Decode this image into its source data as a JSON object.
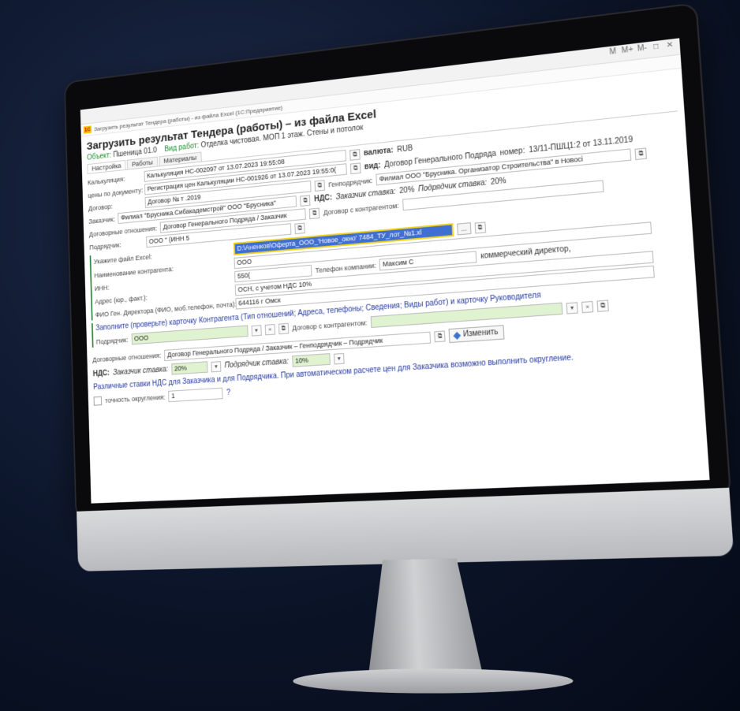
{
  "window": {
    "title": "Загрузить результат Тендера (работы) - из файла Excel (1С:Предприятие)",
    "toolbar": [
      "M",
      "M+",
      "M-",
      "□",
      "✕"
    ]
  },
  "header": {
    "title": "Загрузить результат Тендера (работы) – из файла Excel",
    "object_label": "Объект:",
    "object_value": "Пшеница 01.0",
    "work_label": "Вид работ:",
    "work_value": "Отделка чистовая. МОП 1 этаж. Стены и потолок"
  },
  "tabs": [
    "Настройка",
    "Работы",
    "Материалы"
  ],
  "form": {
    "calc_label": "Калькуляция:",
    "calc_value": "Калькуляция НС-002097 от 13.07.2023 19:55:08",
    "currency_label": "валюта:",
    "currency_value": "RUB",
    "price_doc_label": "цены по документу:",
    "price_doc_value": "Регистрация цен Калькуляции НС-001926 от 13.07.2023 19:55:0(",
    "kind_label": "вид:",
    "kind_value": "Договор Генерального Подряда",
    "number_label": "номер:",
    "number_value": "13/11-ПШЦ1:2 от 13.11.2019",
    "contract_label": "Договор:",
    "contract_value": "Договор №                    т            .2019",
    "general_contractor_label": "Генподрядчик:",
    "general_contractor_value": "Филиал ООО \"Брусника. Организатор Строительства\" в Новосі",
    "customer_label": "Заказчик:",
    "customer_value": "Филиал \"Брусника.Сибакадемстрой\" ООО \"Брусника\"",
    "vat_label": "НДС:",
    "customer_rate_label": "Заказчик ставка:",
    "customer_rate_value": "20%",
    "contractor_rate_label": "Подрядчик ставка:",
    "contractor_rate_value": "20%",
    "relations_label": "Договорные отношения:",
    "relations_value": "Договор Генерального Подряда / Заказчик",
    "counterparty_contract_label": "Договор с контрагентом:",
    "contractor_label": "Подрядчик:",
    "contractor_value": "ООО \"           (ИНН 5"
  },
  "excel": {
    "file_label": "Укажите файл Excel:",
    "file_value": "D:\\Аненков\\Оферта_ООО_'Новое_окно' 7484_ТУ_лот_№1.xl",
    "name_label": "Наименование контрагента:",
    "name_value": "ООО",
    "inn_label": "ИНН:",
    "inn_value": "550(",
    "phone_label": "Телефон компании:",
    "phone_value": "Максим С",
    "director_value": "коммерческий директор,",
    "address_label": "Адрес (юр., факт.):",
    "address_value": "ОСН, с учетом НДС 10%",
    "director_label": "ФИО Ген. Директора (ФИО, моб.телефон, почта):",
    "director_field": "644116 г Омск"
  },
  "card": {
    "title": "Заполните (проверьте) карточку Контрагента (Тип отношений; Адреса, телефоны; Сведения; Виды работ) и карточку Руководителя",
    "contractor_label": "Подрядчик:",
    "contractor_value": "ООО",
    "counterparty_contract_label": "Договор с контрагентом:",
    "relations_label": "Договорные отношения:",
    "relations_value": "Договор Генерального Подряда / Заказчик – Генподрядчик – Подрядчик",
    "change_button": "Изменить",
    "vat_label": "НДС:",
    "customer_rate_label": "Заказчик ставка:",
    "customer_rate_value": "20%",
    "contractor_rate_label": "Подрядчик ставка:",
    "contractor_rate_value": "10%",
    "note": "Различные ставки НДС для Заказчика и для Подрядчика. При автоматическом расчете цен для Заказчика возможно выполнить округление.",
    "rounding_label": "точность округления:",
    "rounding_value": "1",
    "help": "?"
  }
}
